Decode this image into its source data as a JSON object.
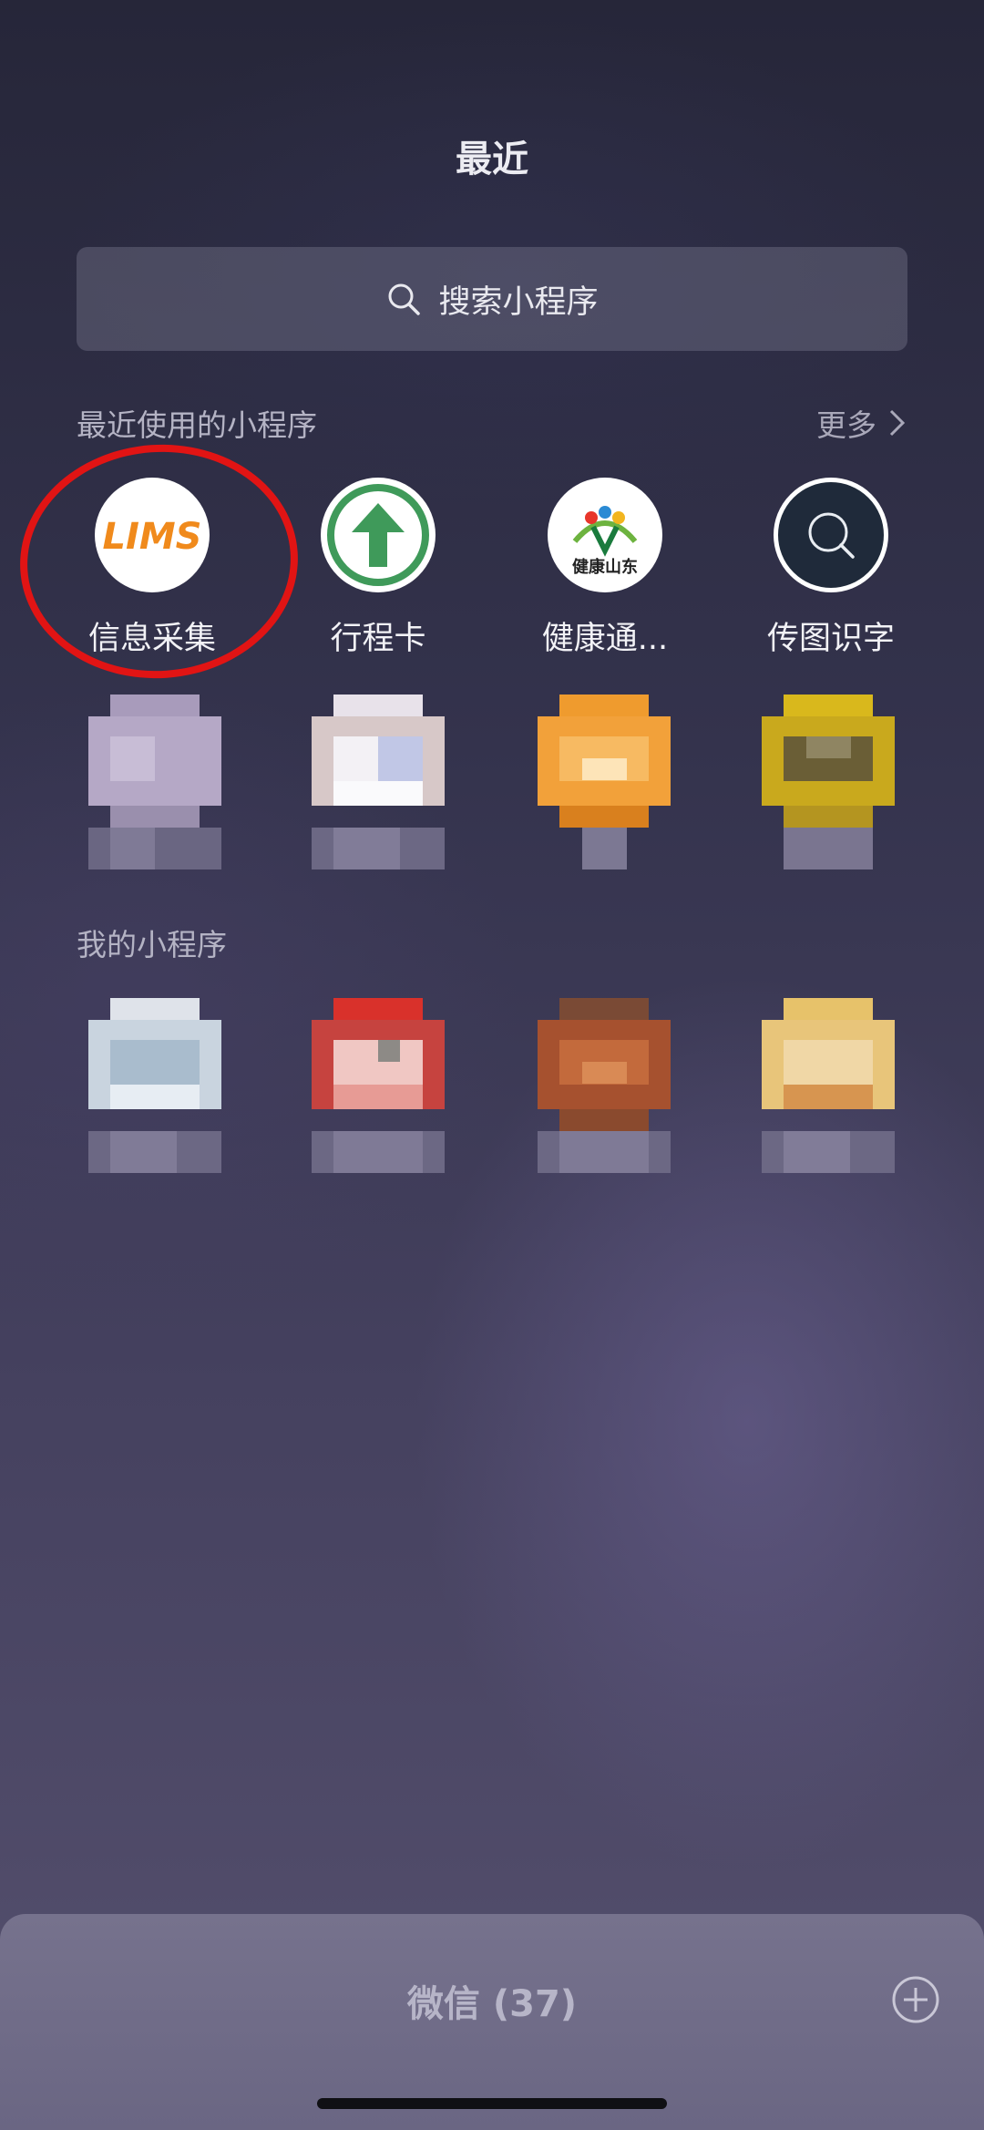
{
  "header": {
    "title": "最近"
  },
  "search": {
    "placeholder": "搜索小程序"
  },
  "recent_section": {
    "label": "最近使用的小程序",
    "more": "更多"
  },
  "recent_apps": [
    {
      "label": "信息采集",
      "logo_text": "LIMS"
    },
    {
      "label": "行程卡"
    },
    {
      "label": "健康通...",
      "logo_text": "健康山东"
    },
    {
      "label": "传图识字"
    }
  ],
  "my_section": {
    "label": "我的小程序"
  },
  "dock": {
    "title": "微信 (37)"
  },
  "colors": {
    "highlight": "#e11414",
    "lims_orange": "#f08a1c",
    "green_arrow": "#3f9a5a"
  }
}
